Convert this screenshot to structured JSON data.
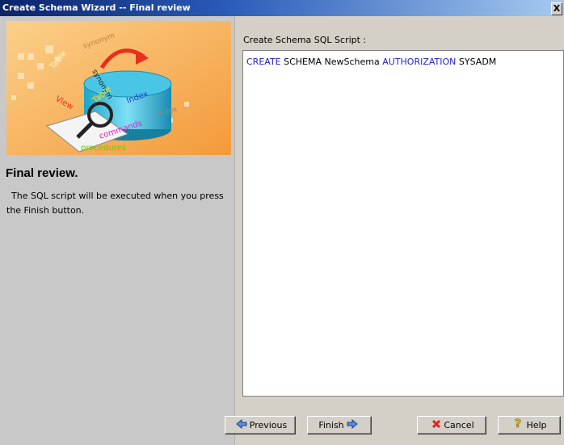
{
  "window": {
    "title": "Create Schema Wizard -- Final review",
    "close_label": "X"
  },
  "banner": {
    "words": [
      "synonym",
      "Table",
      "View",
      "synonym",
      "Table",
      "Index",
      "index",
      "commands",
      "procedures"
    ]
  },
  "step": {
    "title": "Final review.",
    "description": "The SQL script will be executed when you press the Finish button."
  },
  "sql": {
    "label": "Create Schema SQL Script :",
    "tokens": [
      {
        "text": "CREATE",
        "keyword": true
      },
      {
        "text": " SCHEMA NewSchema ",
        "keyword": false
      },
      {
        "text": "AUTHORIZATION",
        "keyword": true
      },
      {
        "text": " SYSADM",
        "keyword": false
      }
    ]
  },
  "buttons": {
    "previous": "Previous",
    "finish": "Finish",
    "cancel": "Cancel",
    "help": "Help"
  },
  "colors": {
    "keyword": "#2323c8",
    "accent_orange": "#f5a94a"
  }
}
